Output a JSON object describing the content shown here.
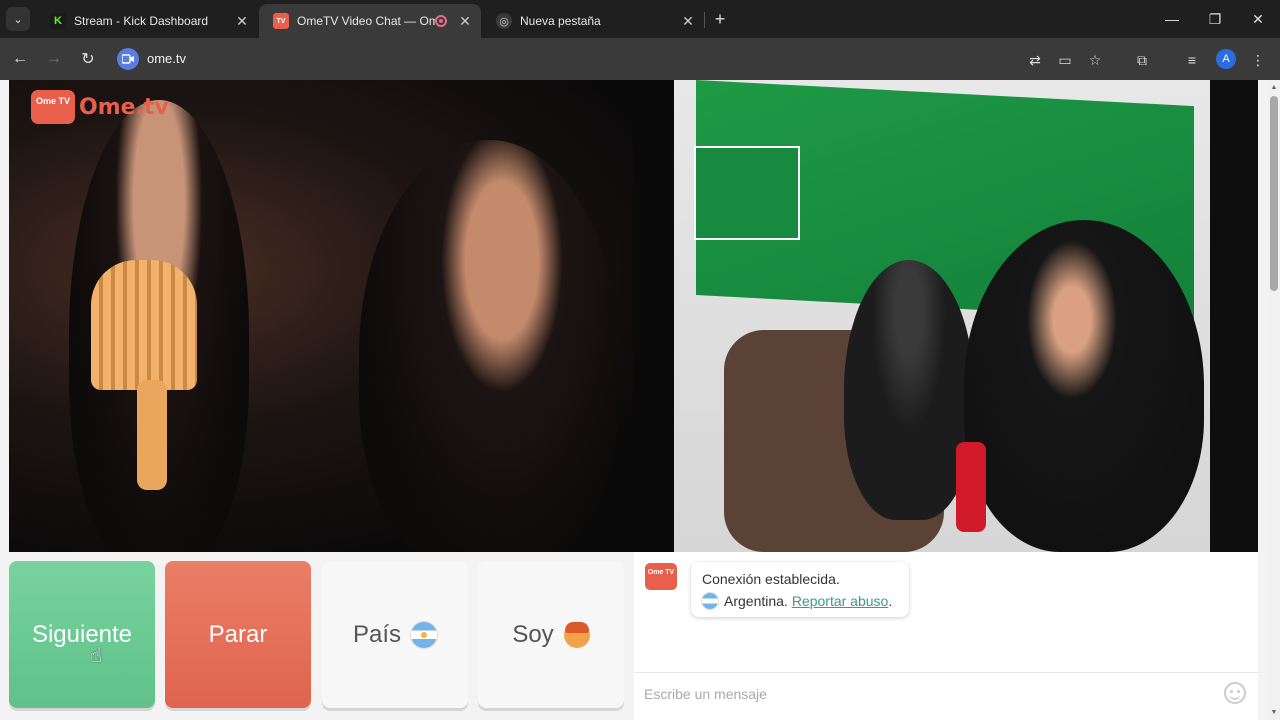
{
  "browser": {
    "tabs": [
      {
        "title": "Stream - Kick Dashboard",
        "close": "✕"
      },
      {
        "title": "OmeTV Video Chat — Ome",
        "close": "✕"
      },
      {
        "title": "Nueva pestaña",
        "close": "✕"
      }
    ],
    "new_tab": "+",
    "url": "ome.tv",
    "profile_initial": "A",
    "window": {
      "minimize": "—",
      "restore": "❐",
      "close": "✕"
    }
  },
  "site": {
    "logo_badge": "Ome TV",
    "logo_text": "Ome.tv"
  },
  "controls": {
    "next_label": "Siguiente",
    "stop_label": "Parar",
    "country_label": "País",
    "gender_label": "Soy"
  },
  "chat": {
    "status_message": "Conexión establecida.",
    "country": "Argentina.",
    "report_link": "Reportar abuso",
    "report_suffix": ".",
    "input_placeholder": "Escribe un mensaje"
  },
  "colors": {
    "next": "#5fc189",
    "stop": "#e0644d",
    "brand": "#e8604c",
    "link": "#3a9a86"
  }
}
